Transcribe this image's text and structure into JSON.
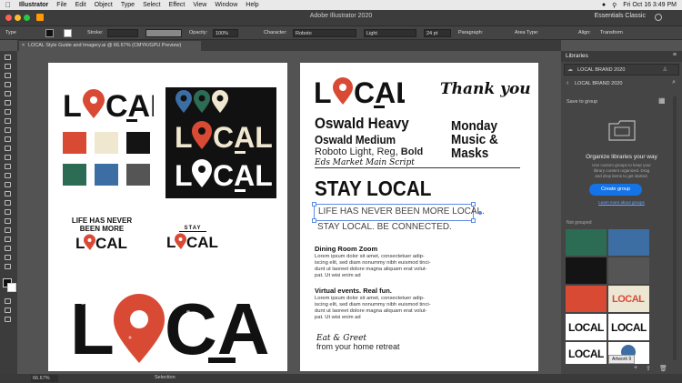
{
  "menubar": {
    "app_name": "Illustrator",
    "items": [
      "File",
      "Edit",
      "Object",
      "Type",
      "Select",
      "Effect",
      "View",
      "Window",
      "Help"
    ],
    "clock": "Fri Oct 16 3:49 PM"
  },
  "window": {
    "title": "Adobe Illustrator 2020",
    "workspace": "Essentials Classic"
  },
  "controlbar": {
    "selection_label": "Type",
    "stroke_label": "Stroke:",
    "opacity_label": "Opacity:",
    "opacity_value": "100%",
    "character_label": "Character:",
    "font_family": "Roboto",
    "font_style": "Light",
    "font_size": "24 pt",
    "paragraph_label": "Paragraph:",
    "area_type_label": "Area Type:",
    "align_label": "Align:",
    "transform_label": "Transform"
  },
  "document_tab": {
    "title": "LOCAL Style Guide and Imagery.ai @ 66.67% (CMYK/GPU Preview)"
  },
  "artboard_left": {
    "logo_word": "LOCAL",
    "swatch_colors": [
      "#d94a35",
      "#efe7cf",
      "#141414",
      "#2c6c55",
      "#3c6ea4",
      "#555555"
    ],
    "tagline_line1": "LIFE HAS NEVER",
    "tagline_line2": "BEEN MORE",
    "stay_word": "STAY"
  },
  "artboard_right": {
    "logo_word": "LOCAL",
    "thank_you": "Thank you",
    "font_heading_1": "Oswald Heavy",
    "font_heading_2": "Oswald Medium",
    "font_line_prefix": "Roboto Light, Reg, ",
    "font_line_bold": "Bold",
    "script_font": "Eds Market Main Script",
    "menu_line1": "Monday",
    "menu_line2": "Music &",
    "menu_line3": "Masks",
    "headline": "STAY LOCAL",
    "subline_1": "LIFE HAS NEVER BEEN MORE LOCAL.",
    "subline_2": "STAY LOCAL. BE CONNECTED.",
    "section1_title": "Dining Room Zoom",
    "section1_body": [
      "Lorem ipsum dolor sit amet, consectetuer adip-",
      "iscing elit, sed diam nonummy nibh euismod tinci-",
      "dunt ut laoreet dolore magna aliquam erat volut-",
      "pat. Ut wisi enim ad"
    ],
    "section2_title": "Virtual events. Real fun.",
    "section2_body": [
      "Lorem ipsum dolor sit amet, consectetuer adip-",
      "iscing elit, sed diam nonummy nibh euismod tinci-",
      "dunt ut laoreet dolore magna aliquam erat volut-",
      "pat. Ut wisi enim ad"
    ],
    "eat_greet": "Eat & Greet",
    "home_retreat": "from your home retreat"
  },
  "libraries_panel": {
    "title": "Libraries",
    "library_name": "LOCAL BRAND 2020",
    "save_to_group": "Save to group",
    "organize_title": "Organize libraries your way",
    "organize_desc": [
      "Use custom groups to keep your",
      "library content organized. Drag",
      "and drop items to get started."
    ],
    "create_group_label": "Create group",
    "learn_more": "Learn more about groups",
    "not_grouped": "Not grouped",
    "tiles": [
      {
        "kind": "color",
        "color": "#2c6c55"
      },
      {
        "kind": "color",
        "color": "#3c6ea4"
      },
      {
        "kind": "color",
        "color": "#141414"
      },
      {
        "kind": "color",
        "color": "#555555"
      },
      {
        "kind": "color",
        "color": "#d94a35"
      },
      {
        "kind": "image",
        "label": "LOCAL"
      },
      {
        "kind": "image",
        "label": "LOCAL"
      },
      {
        "kind": "image",
        "label": "LOCAL"
      },
      {
        "kind": "image",
        "label": "LOCAL"
      }
    ],
    "tooltip": "Artwork 9"
  },
  "statusbar": {
    "zoom": "66.67%",
    "tool": "Selection"
  }
}
